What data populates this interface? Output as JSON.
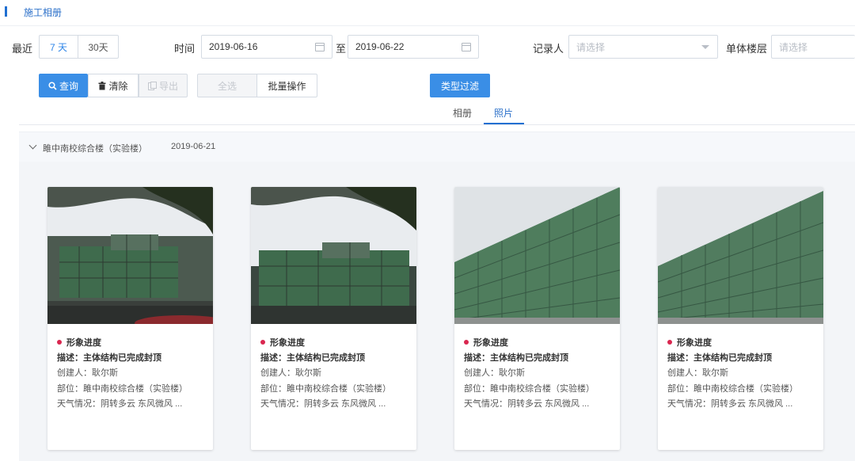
{
  "page": {
    "title": "施工相册"
  },
  "filters": {
    "recent_label": "最近",
    "recent_options": [
      "7 天",
      "30天"
    ],
    "recent_selected": "7 天",
    "time_label": "时间",
    "date_start": "2019-06-16",
    "date_to": "至",
    "date_end": "2019-06-22",
    "recorder_label": "记录人",
    "recorder_placeholder": "请选择",
    "floor_label": "单体楼层",
    "floor_placeholder": "请选择"
  },
  "toolbar": {
    "query": "查询",
    "clear": "清除",
    "export": "导出",
    "select_all": "全选",
    "batch": "批量操作",
    "type_filter": "类型过滤"
  },
  "tabs": [
    "相册",
    "照片"
  ],
  "active_tab": "照片",
  "group": {
    "title": "雎中南校综合楼（实验楼）",
    "date": "2019-06-21"
  },
  "cards": [
    {
      "photo": "building-photo-cloudy-1",
      "tag": "形象进度",
      "desc": "描述：主体结构已完成封顶",
      "creator": "创建人：耿尔斯",
      "location": "部位：雎中南校综合楼（实验楼）",
      "weather": "天气情况：阴转多云 东风微风 ..."
    },
    {
      "photo": "building-photo-cloudy-2",
      "tag": "形象进度",
      "desc": "描述：主体结构已完成封顶",
      "creator": "创建人：耿尔斯",
      "location": "部位：雎中南校综合楼（实验楼）",
      "weather": "天气情况：阴转多云 东风微风 ..."
    },
    {
      "photo": "building-photo-scaffold-1",
      "tag": "形象进度",
      "desc": "描述：主体结构已完成封顶",
      "creator": "创建人：耿尔斯",
      "location": "部位：雎中南校综合楼（实验楼）",
      "weather": "天气情况：阴转多云 东风微风 ..."
    },
    {
      "photo": "building-photo-scaffold-2",
      "tag": "形象进度",
      "desc": "描述：主体结构已完成封顶",
      "creator": "创建人：耿尔斯",
      "location": "部位：雎中南校综合楼（实验楼）",
      "weather": "天气情况：阴转多云 东风微风 ..."
    }
  ],
  "colors": {
    "accent": "#3a8ee6",
    "link": "#2a6fc9",
    "tag_dot": "#d9264f",
    "net_green": "#3f6b4d"
  }
}
